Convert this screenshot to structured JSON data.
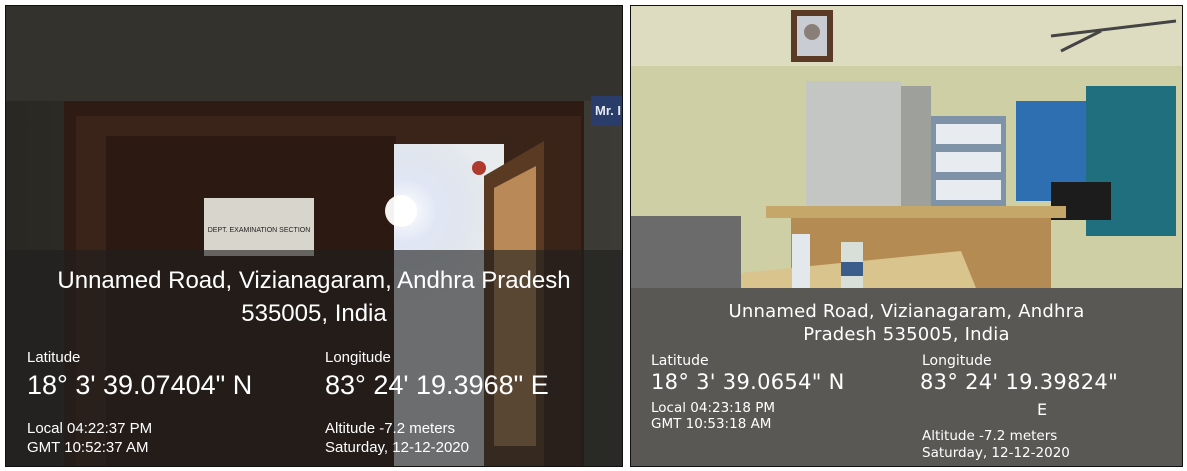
{
  "left_photo": {
    "address_line1": "Unnamed Road, Vizianagaram, Andhra Pradesh",
    "address_line2": "535005, India",
    "latitude_label": "Latitude",
    "latitude_value": "18° 3' 39.07404\" N",
    "longitude_label": "Longitude",
    "longitude_value": "83° 24' 19.3968\" E",
    "local_time": "Local 04:22:37 PM",
    "gmt_time": "GMT 10:52:37 AM",
    "altitude": "Altitude -7.2 meters",
    "date": "Saturday, 12-12-2020",
    "door_sign": "DEPT. EXAMINATION SECTION",
    "name_plate": "Mr. I"
  },
  "right_photo": {
    "address_line1": "Unnamed Road, Vizianagaram, Andhra",
    "address_line2": "Pradesh 535005, India",
    "latitude_label": "Latitude",
    "latitude_value": "18° 3' 39.0654\" N",
    "longitude_label": "Longitude",
    "longitude_value_line1": "83° 24' 19.39824\"",
    "longitude_value_line2": "E",
    "local_time": "Local 04:23:18 PM",
    "gmt_time": "GMT 10:53:18 AM",
    "altitude": "Altitude -7.2 meters",
    "date": "Saturday, 12-12-2020"
  }
}
